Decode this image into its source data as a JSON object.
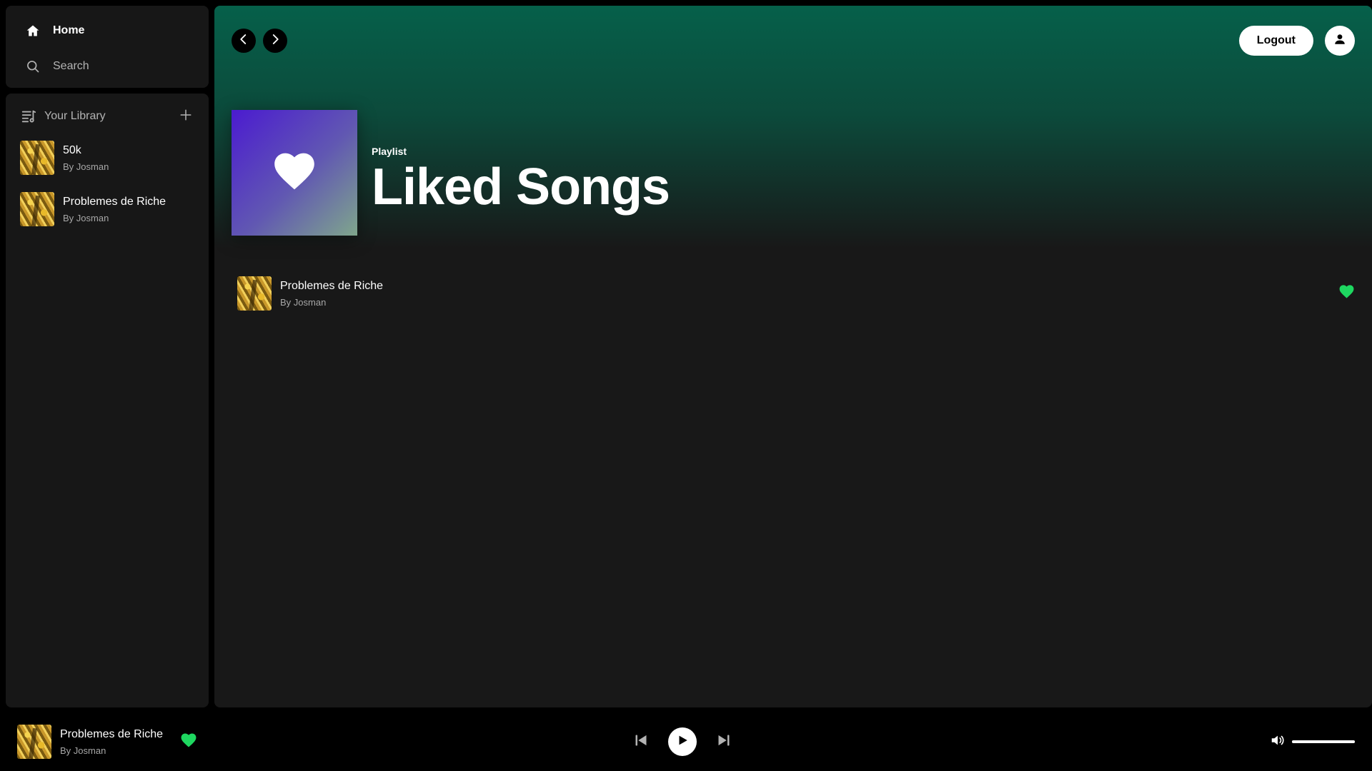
{
  "colors": {
    "accent": "#1ed760",
    "hero_gradient_top": "#06604a",
    "panel_bg": "#171717",
    "main_bg": "#181818"
  },
  "sidebar": {
    "nav": [
      {
        "label": "Home",
        "icon": "home-icon"
      },
      {
        "label": "Search",
        "icon": "search-icon"
      }
    ],
    "library": {
      "title": "Your Library",
      "icon": "library-icon",
      "add_icon": "plus-icon",
      "items": [
        {
          "title": "50k",
          "subtitle": "By Josman"
        },
        {
          "title": "Problemes de Riche",
          "subtitle": "By Josman"
        }
      ]
    }
  },
  "header": {
    "back_icon": "chevron-left-icon",
    "forward_icon": "chevron-right-icon",
    "logout_label": "Logout",
    "user_icon": "user-icon"
  },
  "playlist": {
    "type": "Playlist",
    "title": "Liked Songs",
    "cover_icon": "heart-icon",
    "songs": [
      {
        "title": "Problemes de Riche",
        "subtitle": "By Josman",
        "liked": true
      }
    ]
  },
  "player": {
    "track": {
      "title": "Problemes de Riche",
      "subtitle": "By Josman",
      "liked": true
    },
    "controls": {
      "previous_icon": "skip-previous-icon",
      "play_icon": "play-icon",
      "next_icon": "skip-next-icon"
    },
    "volume_icon": "volume-icon",
    "volume_level": 1.0
  }
}
